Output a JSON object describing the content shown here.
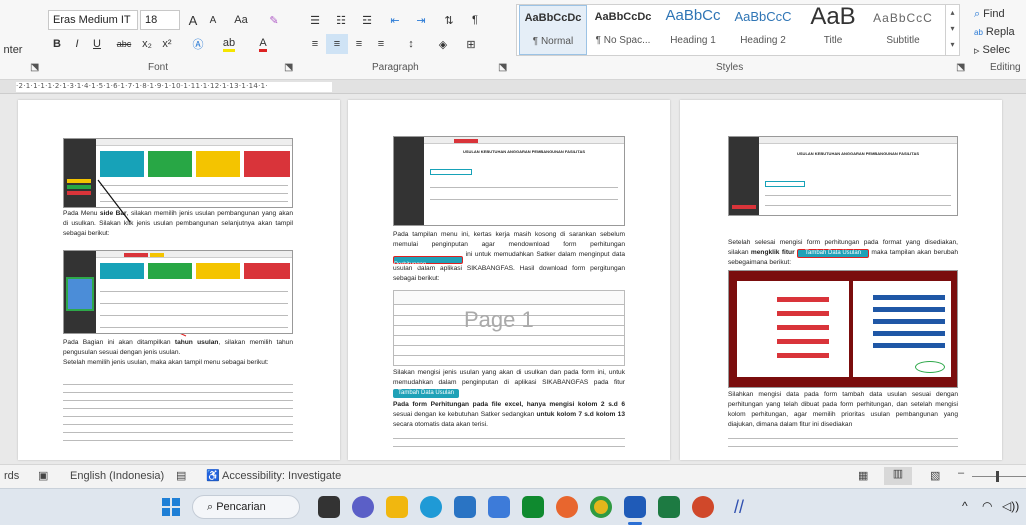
{
  "ribbon": {
    "left_cut_label": "nter",
    "font_name": "Eras Medium IT",
    "font_size": "18",
    "font_group_label": "Font",
    "paragraph_group_label": "Paragraph",
    "styles_group_label": "Styles",
    "editing_group_label": "Editing",
    "grow_font": "A",
    "shrink_font": "A",
    "change_case": "Aa",
    "bold": "B",
    "italic": "I",
    "underline": "U",
    "strike": "abc",
    "subscript": "x₂",
    "superscript": "x²",
    "styles": [
      {
        "sample": "AaBbCcDc",
        "name": "¶ Normal"
      },
      {
        "sample": "AaBbCcDc",
        "name": "¶ No Spac..."
      },
      {
        "sample": "AaBbCc",
        "name": "Heading 1"
      },
      {
        "sample": "AaBbCcC",
        "name": "Heading 2"
      },
      {
        "sample": "AaB",
        "name": "Title"
      },
      {
        "sample": "AaBbCcC",
        "name": "Subtitle"
      }
    ],
    "find": "Find",
    "replace": "Repla",
    "select": "Selec"
  },
  "ruler": {
    "text": "·2·1·1·1·1·2·1·3·1·4·1·5·1·6·1·7·1·8·1·9·1·10·1·11·1·12·1·13·1·14·1·"
  },
  "pages": {
    "p1_text1_a": "Pada Menu ",
    "p1_text1_b": "side Bar",
    "p1_text1_c": ", silakan memilih jenis usulan pembangunan yang akan di usulkan. Silakan klik jenis usulan pembangunan selanjutnya akan tampil sebagai berikut:",
    "p1_text2_a": "Pada Bagian ini akan ditampilkan ",
    "p1_text2_b": "tahun usulan",
    "p1_text2_c": ", silakan memilih tahun pengusulan sesuai dengan jenis usulan.",
    "p1_text3": "Setelah memilih jenis usulan, maka akan tampil menu sebagai berikut:",
    "p2_shot_title": "USULAN KEBUTUHAN ANGGARAN PEMBANGUNAN FASILITAS",
    "p2_text1_a": "Pada tampilan menu ini, kertas kerja masih kosong di sarankan sebelum memulai penginputan agar mendownload form perhitungan ",
    "p2_text1_b": " ini untuk memudahkan Satker dalam menginput data usulan dalam aplikasi SIKABANGFAS. Hasil download form pergitungan sebagai berikut:",
    "p2_download_btn": "Download Format Perhitungan",
    "p2_watermark": "Page 1",
    "p2_text2_a": "Silakan mengisi jenis usulan yang akan di usulkan dan pada form ini, untuk memudahkan dalam penginputan di aplikasi SIKABANGFAS pada fitur ",
    "p2_tambah_btn": "Tambah Data Usulan",
    "p2_text3_a": "Pada form Perhitungan pada file excel, hanya mengisi kolom 2 s.d 6",
    "p2_text3_b": " sesuai dengan ke kebutuhan Satker sedangkan ",
    "p2_text3_c": "untuk kolom 7 s.d kolom 13",
    "p2_text3_d": " secara otomatis data akan terisi.",
    "p3_shot_title": "USULAN KEBUTUHAN ANGGARAN PEMBANGUNAN FASILITAS",
    "p3_text1_a": "Setelah selesai mengisi form perhitungan pada format yang disediakan, silakan ",
    "p3_text1_b": "mengklik fitur",
    "p3_tambah_btn": "Tambah Data Usulan",
    "p3_text1_c": "maka tampilan akan berubah sebegaimana berikut:",
    "p3_text2": "Silahkan mengisi data pada form tambah data usulan sesuai dengan perhitungan yang telah dibuat pada form perhitungan, dan setelah mengisi kolom perhitungan, agar memilih prioritas usulan pembangunan yang diajukan, dimana dalam fitur ini disediakan"
  },
  "status": {
    "words_cut": "rds",
    "language": "English (Indonesia)",
    "accessibility": "Accessibility: Investigate"
  },
  "taskbar": {
    "search": "Pencarian"
  }
}
